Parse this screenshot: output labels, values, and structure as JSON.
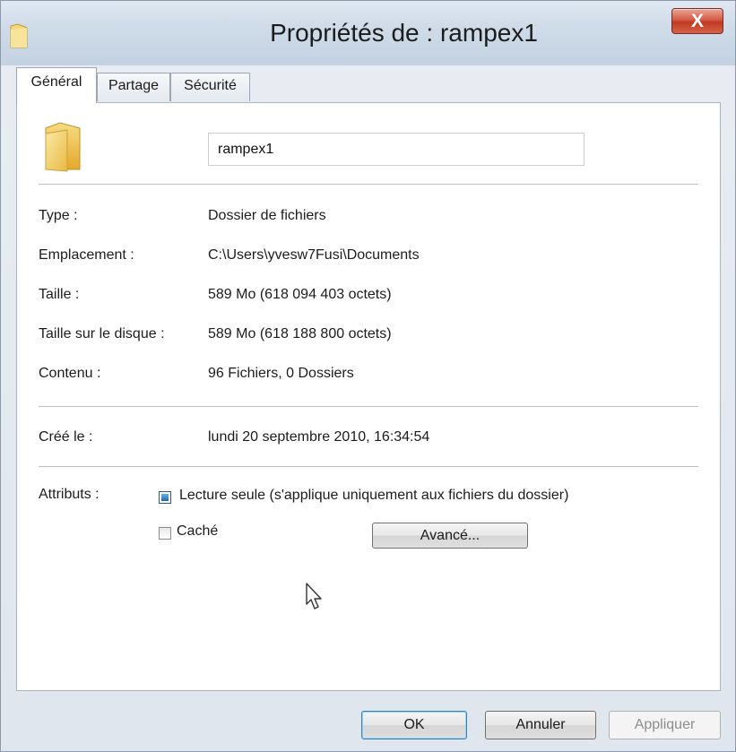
{
  "window": {
    "title": "Propriétés de : rampex1",
    "close_label": "X"
  },
  "tabs": [
    {
      "label": "Général",
      "active": true
    },
    {
      "label": "Partage",
      "active": false
    },
    {
      "label": "Sécurité",
      "active": false
    }
  ],
  "general": {
    "folder_name": "rampex1",
    "rows": [
      {
        "label": "Type :",
        "value": "Dossier de fichiers"
      },
      {
        "label": "Emplacement :",
        "value": "C:\\Users\\yvesw7Fusi\\Documents"
      },
      {
        "label": "Taille :",
        "value": "589 Mo (618 094 403 octets)"
      },
      {
        "label": "Taille sur le disque :",
        "value": "589 Mo (618 188 800 octets)"
      },
      {
        "label": "Contenu :",
        "value": "96 Fichiers, 0 Dossiers"
      }
    ],
    "created": {
      "label": "Créé le :",
      "value": "lundi 20 septembre 2010, 16:34:54"
    },
    "attributes": {
      "label": "Attributs :",
      "readonly": {
        "label": "Lecture seule (s'applique uniquement aux fichiers du dossier)",
        "checked": "indeterminate"
      },
      "hidden": {
        "label": "Caché",
        "checked": false
      },
      "advanced_button": "Avancé..."
    }
  },
  "footer": {
    "ok": "OK",
    "cancel": "Annuler",
    "apply": "Appliquer",
    "apply_disabled": true
  },
  "colors": {
    "close_button": "#d14b33",
    "default_button_glow": "#8ed3f8",
    "checkbox_fill": "#1f6aa8",
    "folder_yellow": "#f3d36b"
  },
  "icons": {
    "title": "folder-icon",
    "main": "folder-icon",
    "cursor": "mouse-pointer-icon"
  }
}
